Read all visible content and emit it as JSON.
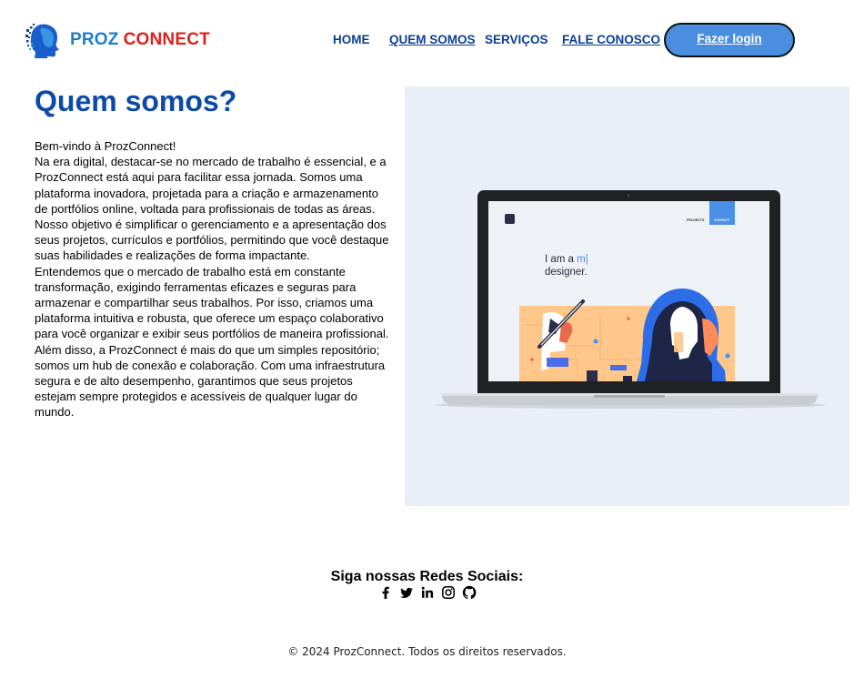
{
  "brand": {
    "part1": "PROZ",
    "part2": "CONNECT"
  },
  "nav": {
    "home": "HOME",
    "about": "QUEM SOMOS",
    "services": "SERVIÇOS",
    "contact": "FALE CONOSCO",
    "login": "Fazer login"
  },
  "main": {
    "title": "Quem somos?",
    "paragraphs": [
      "Bem-vindo à ProzConnect!",
      "Na era digital, destacar-se no mercado de trabalho é essencial, e a ProzConnect está aqui para facilitar essa jornada. Somos uma plataforma inovadora, projetada para a criação e armazenamento de portfólios online, voltada para profissionais de todas as áreas.",
      "Nosso objetivo é simplificar o gerenciamento e a apresentação dos seus projetos, currículos e portfólios, permitindo que você destaque suas habilidades e realizações de forma impactante.",
      "Entendemos que o mercado de trabalho está em constante transformação, exigindo ferramentas eficazes e seguras para armazenar e compartilhar seus trabalhos. Por isso, criamos uma plataforma intuitiva e robusta, que oferece um espaço colaborativo para você organizar e exibir seus portfólios de maneira profissional.",
      "Além disso, a ProzConnect é mais do que um simples repositório; somos um hub de conexão e colaboração. Com uma infraestrutura segura e de alto desempenho, garantimos que seus projetos estejam sempre protegidos e acessíveis de qualquer lugar do mundo."
    ]
  },
  "illustration": {
    "nav_projects": "PROJECTS",
    "nav_contact": "CONTACT",
    "line1_prefix": "I am a ",
    "line1_typed": "m|",
    "line2": "designer."
  },
  "footer": {
    "social_title": "Siga nossas Redes Sociais:",
    "icons": [
      "facebook-icon",
      "twitter-icon",
      "linkedin-icon",
      "instagram-icon",
      "github-icon"
    ],
    "copyright": "© 2024 ProzConnect. Todos os direitos reservados."
  },
  "colors": {
    "nav_text": "#0b3f94",
    "title": "#0b4aa8",
    "login_bg": "#4a8fdf",
    "brand_blue": "#1f7ec9",
    "brand_red": "#e0201b",
    "illustration_bg": "#e9eef7"
  }
}
